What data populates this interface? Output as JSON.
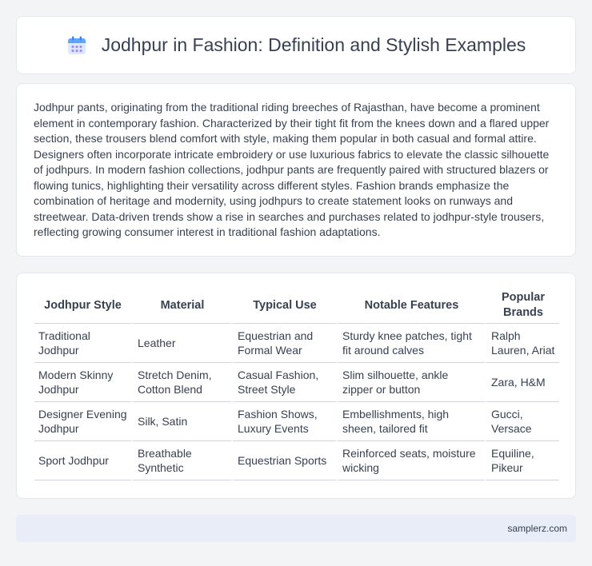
{
  "header": {
    "title": "Jodhpur in Fashion: Definition and Stylish Examples",
    "icon": "calendar-icon",
    "icon_colors": {
      "top": "#60a5fa",
      "body": "#dbeafe",
      "dots": "#a78bfa"
    }
  },
  "intro": {
    "text": "Jodhpur pants, originating from the traditional riding breeches of Rajasthan, have become a prominent element in contemporary fashion. Characterized by their tight fit from the knees down and a flared upper section, these trousers blend comfort with style, making them popular in both casual and formal attire. Designers often incorporate intricate embroidery or use luxurious fabrics to elevate the classic silhouette of jodhpurs. In modern fashion collections, jodhpur pants are frequently paired with structured blazers or flowing tunics, highlighting their versatility across different styles. Fashion brands emphasize the combination of heritage and modernity, using jodhpurs to create statement looks on runways and streetwear. Data-driven trends show a rise in searches and purchases related to jodhpur-style trousers, reflecting growing consumer interest in traditional fashion adaptations."
  },
  "table": {
    "headers": [
      "Jodhpur Style",
      "Material",
      "Typical Use",
      "Notable Features",
      "Popular Brands"
    ],
    "rows": [
      [
        "Traditional Jodhpur",
        "Leather",
        "Equestrian and Formal Wear",
        "Sturdy knee patches, tight fit around calves",
        "Ralph Lauren, Ariat"
      ],
      [
        "Modern Skinny Jodhpur",
        "Stretch Denim, Cotton Blend",
        "Casual Fashion, Street Style",
        "Slim silhouette, ankle zipper or button",
        "Zara, H&M"
      ],
      [
        "Designer Evening Jodhpur",
        "Silk, Satin",
        "Fashion Shows, Luxury Events",
        "Embellishments, high sheen, tailored fit",
        "Gucci, Versace"
      ],
      [
        "Sport Jodhpur",
        "Breathable Synthetic",
        "Equestrian Sports",
        "Reinforced seats, moisture wicking",
        "Equiline, Pikeur"
      ]
    ]
  },
  "footer": {
    "site": "samplerz.com"
  }
}
